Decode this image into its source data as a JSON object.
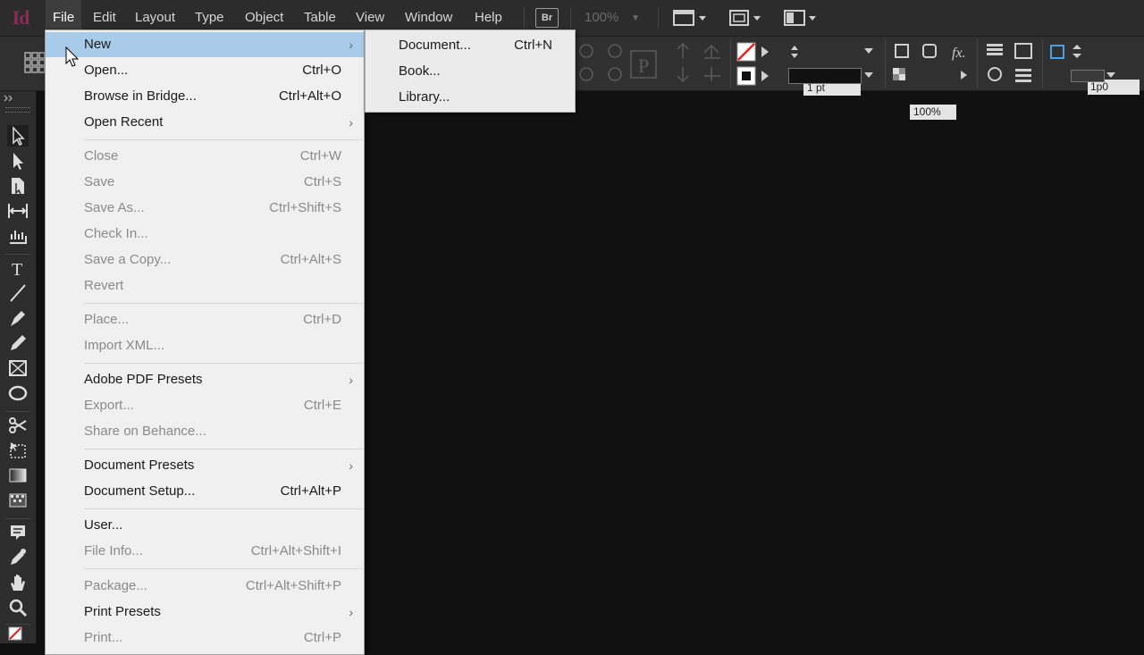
{
  "app": {
    "logo_text": "Id"
  },
  "menubar": {
    "items": [
      {
        "label": "File",
        "active": true
      },
      {
        "label": "Edit"
      },
      {
        "label": "Layout"
      },
      {
        "label": "Type"
      },
      {
        "label": "Object"
      },
      {
        "label": "Table"
      },
      {
        "label": "View"
      },
      {
        "label": "Window"
      },
      {
        "label": "Help"
      }
    ],
    "bridge_badge": "Br",
    "zoom": "100%"
  },
  "controlbar": {
    "stroke_weight": "1 pt",
    "opacity": "100%",
    "offset": "1p0"
  },
  "file_menu": {
    "items": [
      {
        "label": "New",
        "shortcut": "",
        "submenu": true,
        "highlighted": true
      },
      {
        "label": "Open...",
        "shortcut": "Ctrl+O"
      },
      {
        "label": "Browse in Bridge...",
        "shortcut": "Ctrl+Alt+O"
      },
      {
        "label": "Open Recent",
        "shortcut": "",
        "submenu": true
      },
      {
        "label": "Close",
        "shortcut": "Ctrl+W",
        "disabled": true
      },
      {
        "label": "Save",
        "shortcut": "Ctrl+S",
        "disabled": true
      },
      {
        "label": "Save As...",
        "shortcut": "Ctrl+Shift+S",
        "disabled": true
      },
      {
        "label": "Check In...",
        "shortcut": "",
        "disabled": true
      },
      {
        "label": "Save a Copy...",
        "shortcut": "Ctrl+Alt+S",
        "disabled": true
      },
      {
        "label": "Revert",
        "shortcut": "",
        "disabled": true
      },
      {
        "label": "Place...",
        "shortcut": "Ctrl+D",
        "disabled": true
      },
      {
        "label": "Import XML...",
        "shortcut": "",
        "disabled": true
      },
      {
        "label": "Adobe PDF Presets",
        "shortcut": "",
        "submenu": true
      },
      {
        "label": "Export...",
        "shortcut": "Ctrl+E",
        "disabled": true
      },
      {
        "label": "Share on Behance...",
        "shortcut": "",
        "disabled": true
      },
      {
        "label": "Document Presets",
        "shortcut": "",
        "submenu": true
      },
      {
        "label": "Document Setup...",
        "shortcut": "Ctrl+Alt+P"
      },
      {
        "label": "User...",
        "shortcut": ""
      },
      {
        "label": "File Info...",
        "shortcut": "Ctrl+Alt+Shift+I",
        "disabled": true
      },
      {
        "label": "Package...",
        "shortcut": "Ctrl+Alt+Shift+P",
        "disabled": true
      },
      {
        "label": "Print Presets",
        "shortcut": "",
        "submenu": true
      },
      {
        "label": "Print...",
        "shortcut": "Ctrl+P",
        "disabled": true
      }
    ]
  },
  "new_submenu": {
    "items": [
      {
        "label": "Document...",
        "shortcut": "Ctrl+N"
      },
      {
        "label": "Book...",
        "shortcut": ""
      },
      {
        "label": "Library...",
        "shortcut": ""
      }
    ]
  },
  "colors": {
    "menu_highlight": "#a9cbea",
    "app_logo": "#8b2a55",
    "canvas": "#111111"
  }
}
